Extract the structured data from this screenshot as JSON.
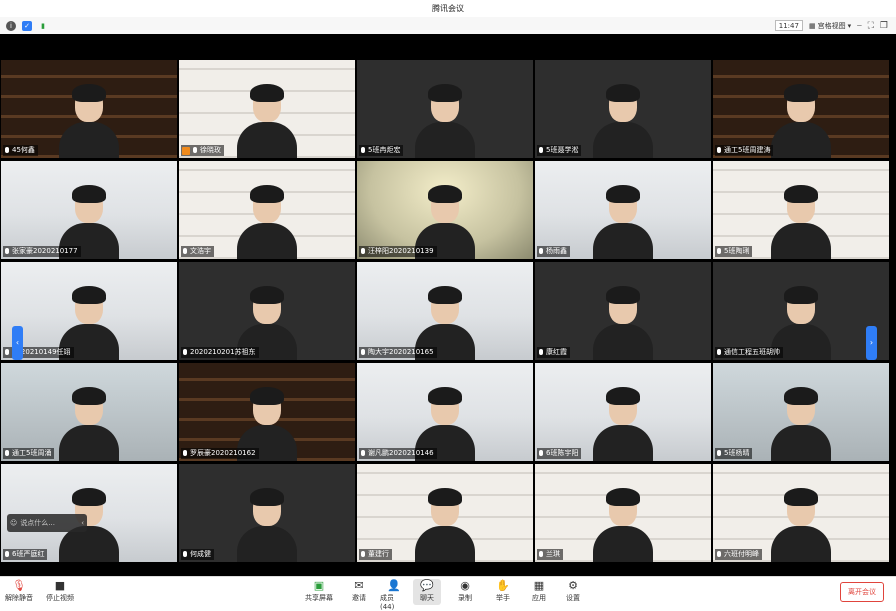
{
  "window": {
    "title": "腾讯会议"
  },
  "topbar": {
    "time": "11:47",
    "view_label": "宫格视图"
  },
  "tiles": [
    {
      "name": "45何鑫",
      "bg": "shelf"
    },
    {
      "name": "徐晓玫",
      "bg": "bookcase",
      "cam_off": true
    },
    {
      "name": "5班冉炬宏",
      "bg": "dark"
    },
    {
      "name": "5班聂学淞",
      "bg": "dark"
    },
    {
      "name": "通工5班周建涛",
      "bg": "shelf"
    },
    {
      "name": "张家豪2020210177",
      "bg": "office"
    },
    {
      "name": "文浩宇",
      "bg": "bookcase"
    },
    {
      "name": "汪梓阳2020210139",
      "bg": "blur"
    },
    {
      "name": "杨雨鑫",
      "bg": "office"
    },
    {
      "name": "5班陶琍",
      "bg": "bookcase"
    },
    {
      "name": "2020210149任翊",
      "bg": "office"
    },
    {
      "name": "2020210201苏祖东",
      "bg": "dark"
    },
    {
      "name": "陶大宇2020210165",
      "bg": "office"
    },
    {
      "name": "康红霞",
      "bg": "dark"
    },
    {
      "name": "通信工程五班胡帅",
      "bg": "dark"
    },
    {
      "name": "通工5班周涌",
      "bg": "win"
    },
    {
      "name": "罗辰豪2020210162",
      "bg": "shelf"
    },
    {
      "name": "谢凡鹏2020210146",
      "bg": "office"
    },
    {
      "name": "6班陈宇阳",
      "bg": "office"
    },
    {
      "name": "5班杨晴",
      "bg": "win"
    },
    {
      "name": "6班严庭红",
      "bg": "office"
    },
    {
      "name": "何成健",
      "bg": "dark"
    },
    {
      "name": "董建行",
      "bg": "bookcase"
    },
    {
      "name": "兰琪",
      "bg": "bookcase"
    },
    {
      "name": "六班付明峰",
      "bg": "bookcase"
    }
  ],
  "floating": {
    "placeholder": "说点什么..."
  },
  "toolbar": {
    "mute": "解除静音",
    "video": "停止视频",
    "share": "共享屏幕",
    "invite": "邀请",
    "members": "成员(44)",
    "chat": "聊天",
    "record": "录制",
    "raise_hand": "举手",
    "apps": "应用",
    "settings": "设置",
    "leave": "离开会议"
  }
}
